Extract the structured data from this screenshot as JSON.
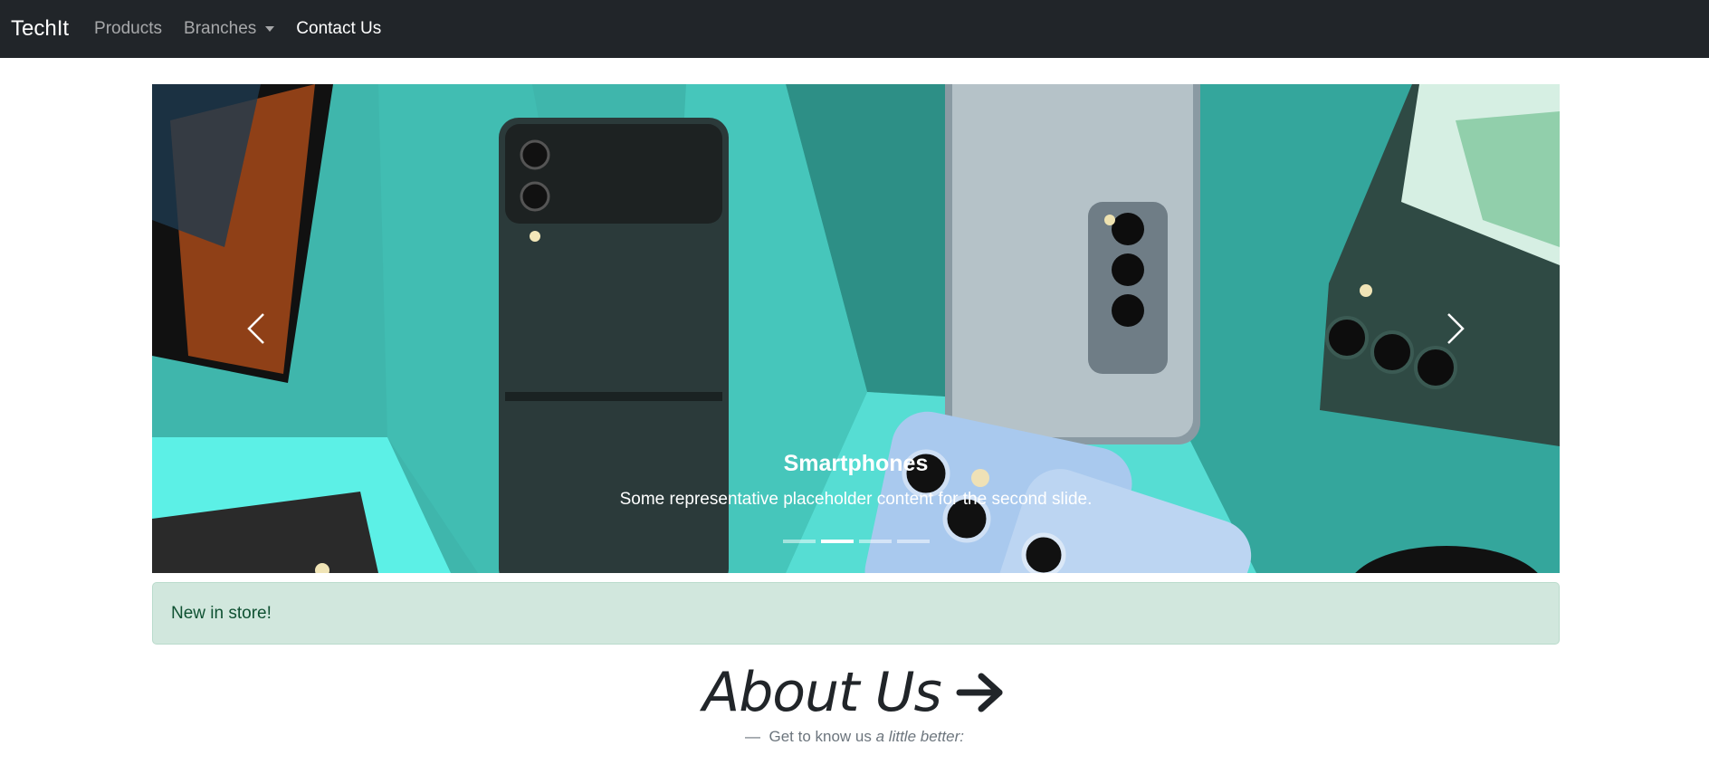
{
  "navbar": {
    "brand": "TechIt",
    "items": [
      {
        "label": "Products"
      },
      {
        "label": "Branches"
      },
      {
        "label": "Contact Us"
      }
    ]
  },
  "carousel": {
    "caption_title": "Smartphones",
    "caption_text": "Some representative placeholder content for the second slide.",
    "slide_count": 4,
    "active_slide": 2
  },
  "alert": {
    "text": "New in store!"
  },
  "about": {
    "title": "About Us",
    "subtitle_dash": "—",
    "subtitle_plain": "Get to know us",
    "subtitle_emph": "a little better:"
  },
  "colors": {
    "navbar": "#212529",
    "carousel_bg": "#3fb6ac",
    "alert_bg": "#d1e7dd",
    "alert_text": "#0f5132"
  },
  "icons": [
    "chevron-left-icon",
    "chevron-right-icon",
    "caret-down-icon",
    "arrow-right-icon"
  ]
}
